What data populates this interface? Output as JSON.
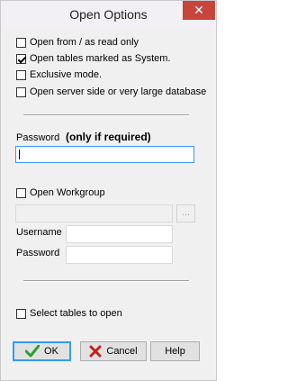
{
  "window": {
    "title": "Open Options",
    "close_glyph": "✕"
  },
  "options": [
    {
      "label": "Open from / as read only",
      "checked": false
    },
    {
      "label": "Open tables marked as System.",
      "checked": true
    },
    {
      "label": "Exclusive mode.",
      "checked": false
    },
    {
      "label": "Open server side or very large database",
      "checked": false
    }
  ],
  "password_section": {
    "label": "Password",
    "hint": "(only if required)",
    "value": ""
  },
  "workgroup": {
    "checkbox_label": "Open Workgroup",
    "checked": false,
    "path_value": "",
    "browse_label": "...",
    "username_label": "Username",
    "username_value": "",
    "password_label": "Password",
    "password_value": ""
  },
  "select_tables": {
    "label": "Select tables to open",
    "checked": false
  },
  "buttons": {
    "ok": "OK",
    "cancel": "Cancel",
    "help": "Help"
  },
  "colors": {
    "close_bg": "#c7453b",
    "focus": "#3399ff",
    "ok_icon": "#2e9e2e",
    "cancel_icon": "#c02020"
  }
}
